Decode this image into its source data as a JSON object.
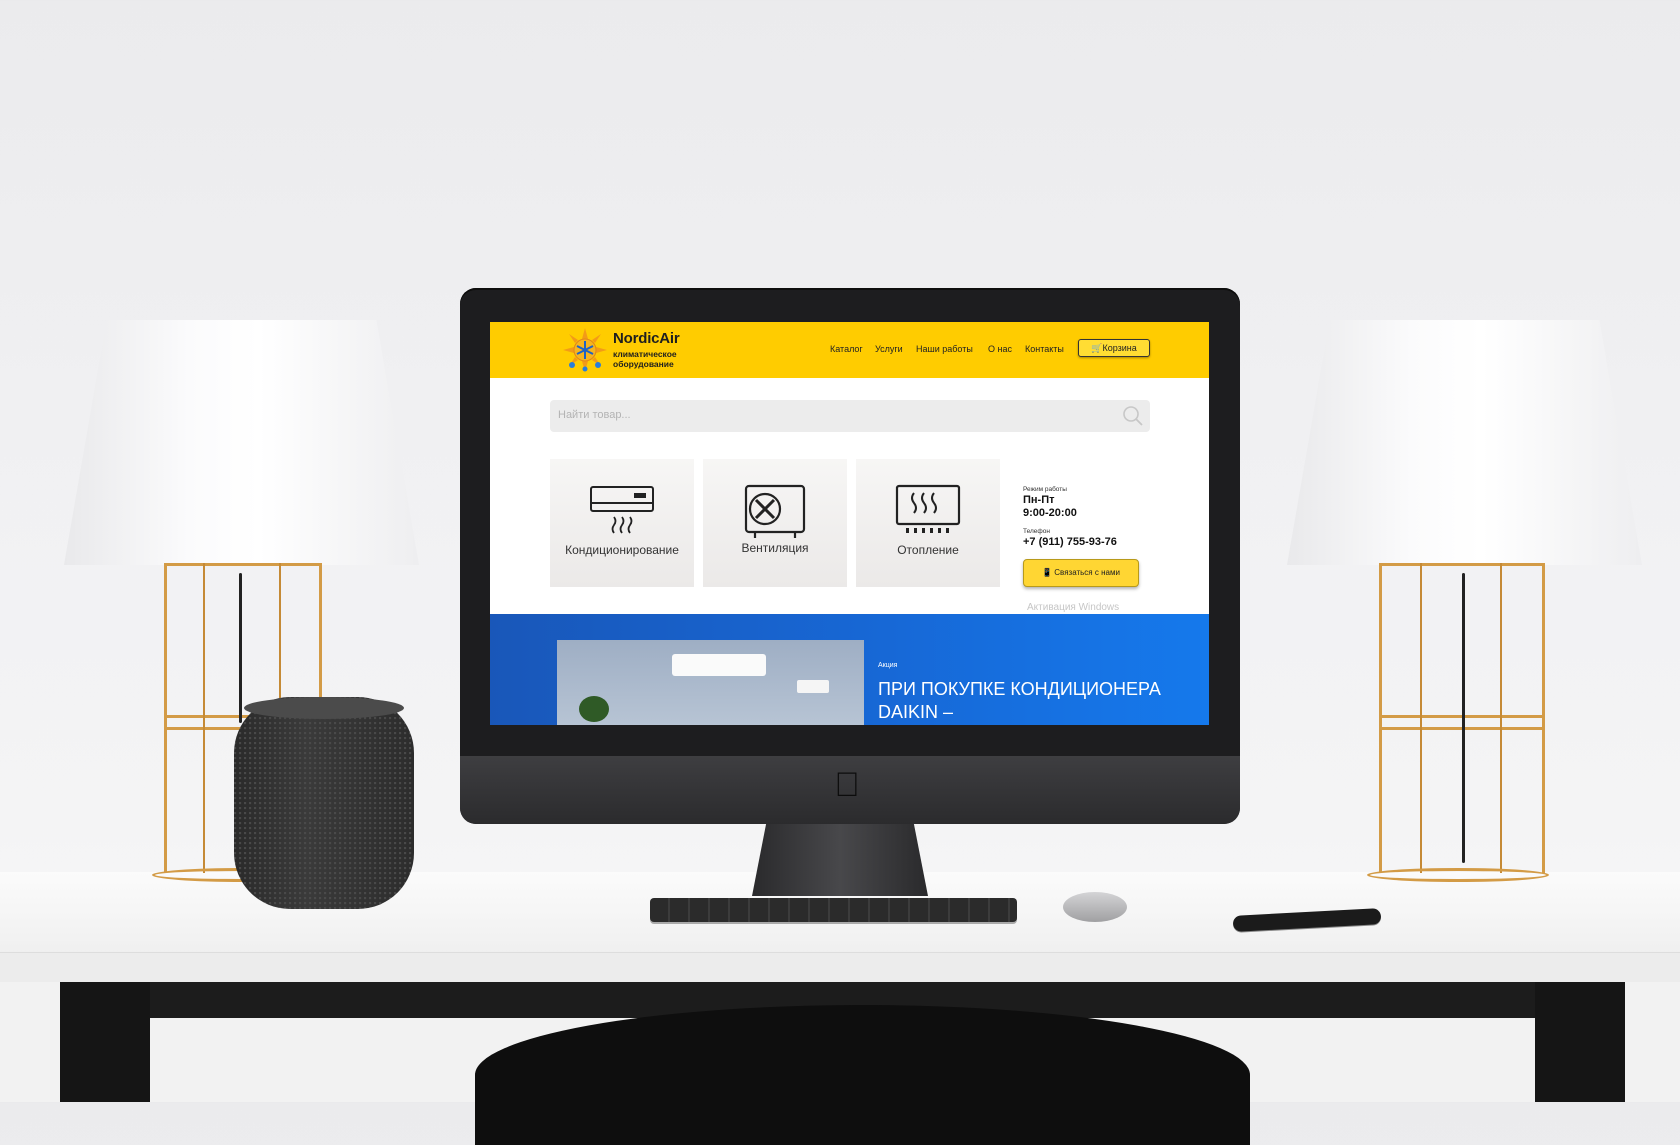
{
  "site": {
    "brand_name": "NordicAir",
    "brand_sub": "климатическое оборудование",
    "nav": [
      "Каталог",
      "Услуги",
      "Наши работы",
      "О нас",
      "Контакты"
    ],
    "cart_label": "Корзина",
    "search_placeholder": "Найти товар...",
    "categories": [
      {
        "label": "Кондиционирование",
        "icon": "air-conditioner-icon"
      },
      {
        "label": "Вентиляция",
        "icon": "fan-icon"
      },
      {
        "label": "Отопление",
        "icon": "heater-icon"
      }
    ],
    "hours_label": "Режим работы",
    "hours_days": "Пн-Пт",
    "hours_time": "9:00-20:00",
    "phone_label": "Телефон",
    "phone": "+7 (911) 755-93-76",
    "contact_button": "Связаться с нами",
    "windows_watermark": "Активация Windows",
    "promo_tag": "Акция",
    "promo_title": "ПРИ ПОКУПКЕ КОНДИЦИОНЕРА DAIKIN –"
  },
  "colors": {
    "header_yellow": "#ffcc00",
    "promo_blue": "#1768d6"
  }
}
